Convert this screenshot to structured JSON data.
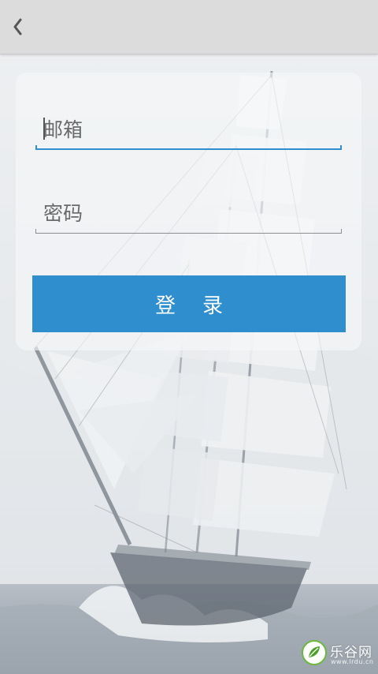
{
  "topbar": {
    "back_icon": "chevron-left-icon"
  },
  "login_form": {
    "email_placeholder": "邮箱",
    "email_value": "",
    "password_placeholder": "密码",
    "password_value": "",
    "submit_label": "登录"
  },
  "background": {
    "description_icon": "sailing-ship-illustration"
  },
  "watermark": {
    "logo_icon": "leaf-logo-icon",
    "text": "乐谷网",
    "subtext": "www.lrdu.cn"
  },
  "colors": {
    "accent": "#2e8ece",
    "input_active_underline": "#2f8fce",
    "input_underline": "#8e8e8e",
    "topbar": "#dcdcdc"
  }
}
